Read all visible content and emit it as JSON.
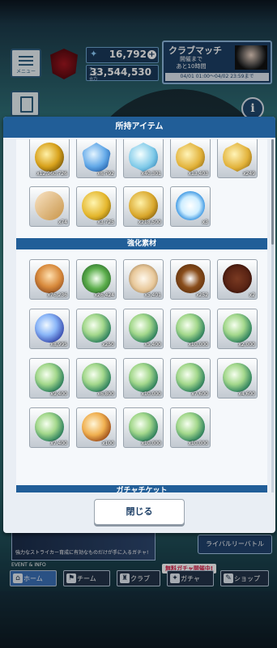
{
  "top": {
    "menu_label": "メニュー",
    "currency": "16,792",
    "power_label": "チーム総合力",
    "power": "33,544,530",
    "club_match": {
      "title": "クラブマッチ",
      "remaining": "開催まで\nあと10時間",
      "period": "04/01 01:00〜04/02 23:59まで"
    }
  },
  "modal": {
    "title": "所持アイテム",
    "close_label": "閉じる",
    "section_enhance": "強化素材",
    "section_gacha": "ガチャチケット",
    "items_top": [
      {
        "art": "art-medal",
        "count": "x12,960,726"
      },
      {
        "art": "art-blue",
        "count": "x6,792"
      },
      {
        "art": "art-hex",
        "count": "x40,301"
      },
      {
        "art": "art-goldhex",
        "count": "x13,403"
      },
      {
        "art": "art-goldhex",
        "count": "x249"
      },
      {
        "art": "art-ticket",
        "count": "x74"
      },
      {
        "art": "art-ball",
        "count": "x3,725"
      },
      {
        "art": "art-coin",
        "count": "x218,500"
      },
      {
        "art": "art-watch",
        "count": "x3"
      }
    ],
    "items_enhance": [
      {
        "art": "art-food",
        "count": "x76,236"
      },
      {
        "art": "art-salad",
        "count": "x26,424"
      },
      {
        "art": "art-gyoza",
        "count": "x5,401"
      },
      {
        "art": "art-curry",
        "count": "x252"
      },
      {
        "art": "art-steak",
        "count": "x2"
      },
      {
        "art": "art-orb-blue",
        "count": "x8,995"
      },
      {
        "art": "art-orb-green",
        "count": "x250"
      },
      {
        "art": "art-orb-green",
        "count": "x5,400"
      },
      {
        "art": "art-orb-green",
        "count": "x10,000"
      },
      {
        "art": "art-orb-green",
        "count": "x2,000"
      },
      {
        "art": "art-orb-green",
        "count": "x9,400"
      },
      {
        "art": "art-orb-green",
        "count": "x6,800"
      },
      {
        "art": "art-orb-green",
        "count": "x10,000"
      },
      {
        "art": "art-orb-green",
        "count": "x7,600"
      },
      {
        "art": "art-orb-green",
        "count": "x4,600"
      },
      {
        "art": "art-orb-green",
        "count": "x7,400"
      },
      {
        "art": "art-orb-gold",
        "count": "x100"
      },
      {
        "art": "art-orb-green",
        "count": "x10,000"
      },
      {
        "art": "art-orb-green",
        "count": "x10,000"
      }
    ]
  },
  "bottom": {
    "banner_text": "強力なストライカー育成に有効なものだけが手に入るガチャ!",
    "event_info": "EVENT & INFO",
    "rival_battle": "ライバルリーバトル",
    "free_gacha": "無料ガチャ開催中!",
    "tabs": [
      {
        "label": "ホーム",
        "icon": "⌂"
      },
      {
        "label": "チーム",
        "icon": "⚑"
      },
      {
        "label": "クラブ",
        "icon": "♜"
      },
      {
        "label": "ガチャ",
        "icon": "✦"
      },
      {
        "label": "ショップ",
        "icon": "✎"
      }
    ]
  }
}
